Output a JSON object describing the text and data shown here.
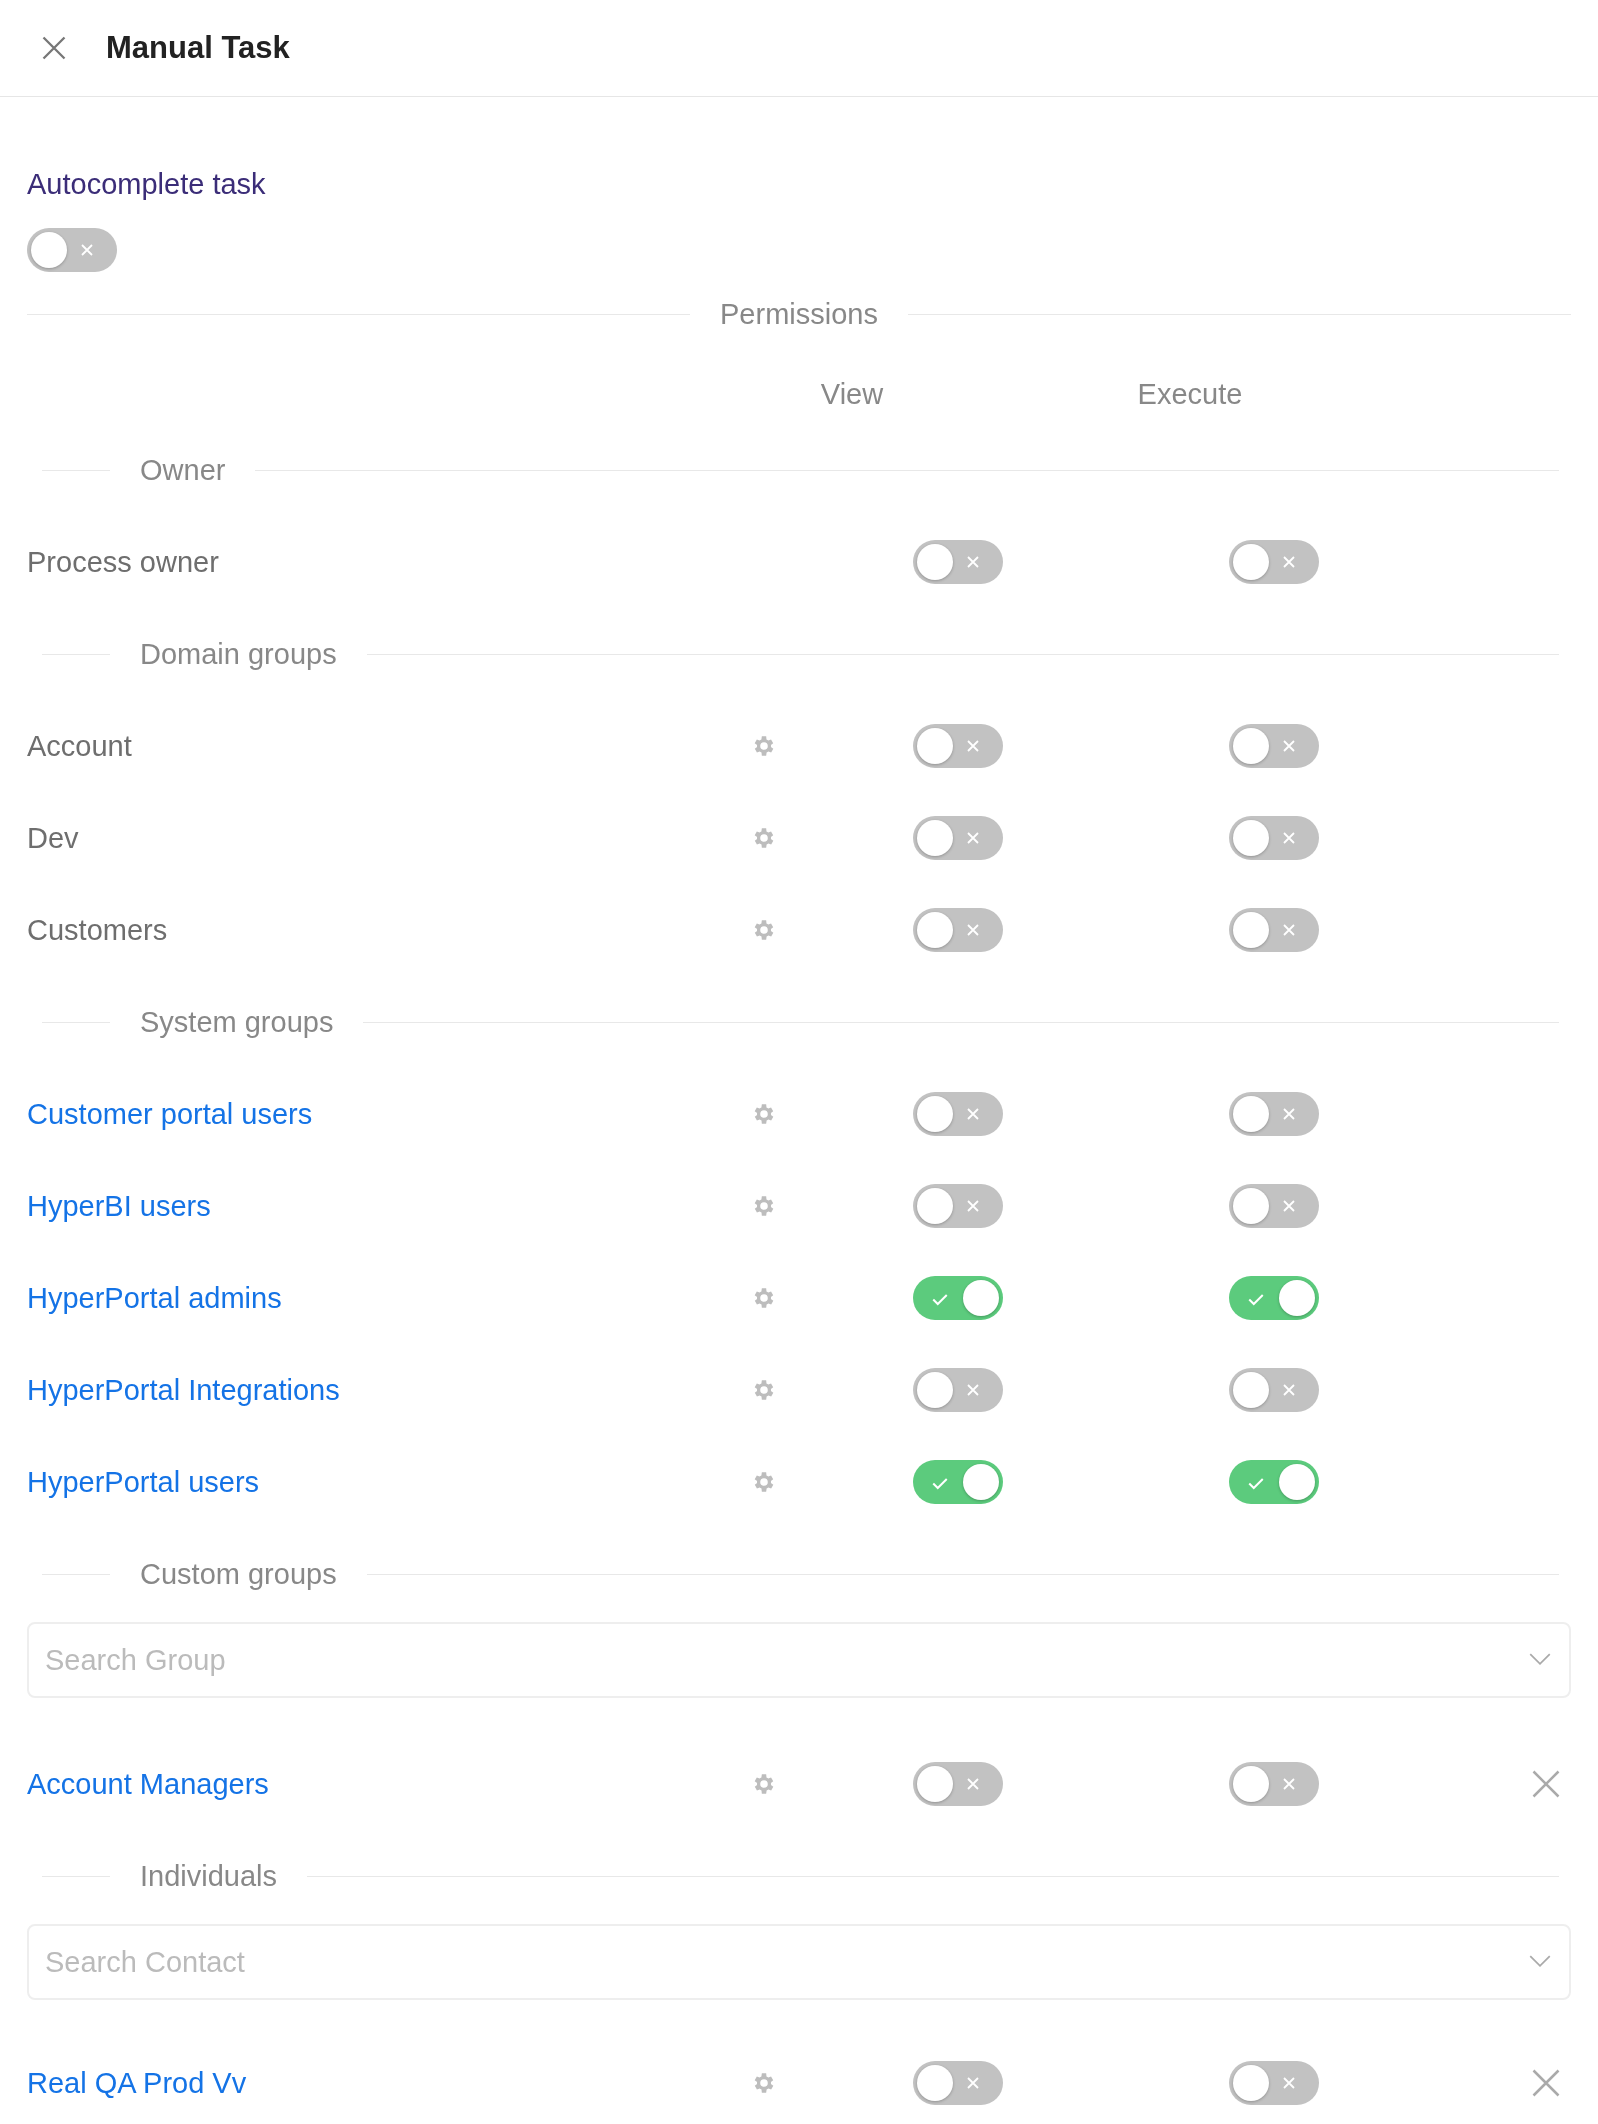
{
  "header": {
    "title": "Manual Task"
  },
  "autocomplete": {
    "label": "Autocomplete task",
    "on": false
  },
  "permissions": {
    "title": "Permissions",
    "columns": [
      "View",
      "Execute"
    ],
    "sections": [
      {
        "title": "Owner",
        "rows": [
          {
            "kind": "owner",
            "name": "Process owner",
            "view": false,
            "execute": false
          }
        ]
      },
      {
        "title": "Domain groups",
        "rows": [
          {
            "kind": "domain",
            "name": "Account",
            "view": false,
            "execute": false
          },
          {
            "kind": "domain",
            "name": "Dev",
            "view": false,
            "execute": false
          },
          {
            "kind": "domain",
            "name": "Customers",
            "view": false,
            "execute": false
          }
        ]
      },
      {
        "title": "System groups",
        "rows": [
          {
            "kind": "system",
            "name": "Customer portal users",
            "view": false,
            "execute": false
          },
          {
            "kind": "system",
            "name": "HyperBI users",
            "view": false,
            "execute": false
          },
          {
            "kind": "system",
            "name": "HyperPortal admins",
            "view": true,
            "execute": true
          },
          {
            "kind": "system",
            "name": "HyperPortal Integrations",
            "view": false,
            "execute": false
          },
          {
            "kind": "system",
            "name": "HyperPortal users",
            "view": true,
            "execute": true
          }
        ]
      },
      {
        "title": "Custom groups",
        "search": {
          "placeholder": "Search Group"
        },
        "rows": [
          {
            "kind": "custom",
            "name": "Account Managers",
            "view": false,
            "execute": false
          }
        ]
      },
      {
        "title": "Individuals",
        "search": {
          "placeholder": "Search Contact"
        },
        "rows": [
          {
            "kind": "custom",
            "name": "Real QA Prod Vv",
            "view": false,
            "execute": false
          }
        ]
      }
    ]
  }
}
